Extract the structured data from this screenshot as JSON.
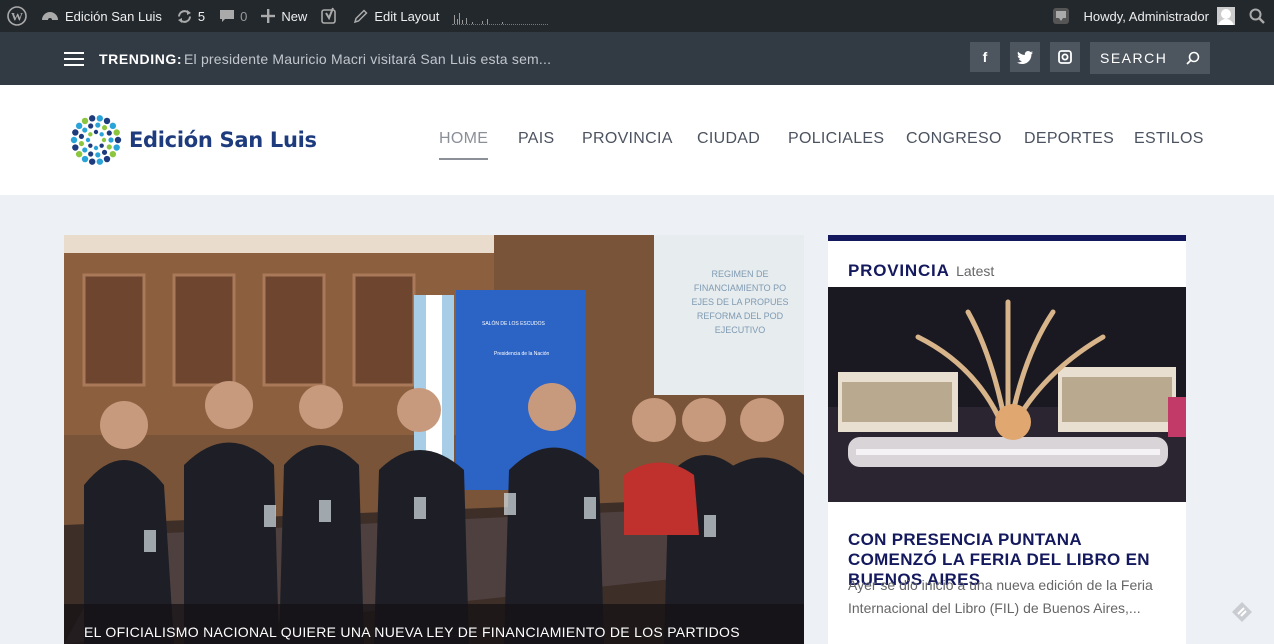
{
  "adminbar": {
    "site_name": "Edición San Luis",
    "updates_count": "5",
    "comments_count": "0",
    "new_label": "New",
    "edit_layout_label": "Edit Layout",
    "howdy_label": "Howdy, Administrador"
  },
  "trending": {
    "label": "TRENDING:",
    "headline": "El presidente Mauricio Macri visitará San Luis esta sem..."
  },
  "social": {
    "facebook_glyph": "f",
    "search_placeholder": "SEARCH"
  },
  "logo": {
    "text": "Edición San Luis"
  },
  "nav": {
    "items": [
      "HOME",
      "PAIS",
      "PROVINCIA",
      "CIUDAD",
      "POLICIALES",
      "CONGRESO",
      "DEPORTES",
      "ESTILOS"
    ],
    "active": "HOME"
  },
  "hero": {
    "title": "EL OFICIALISMO NACIONAL QUIERE UNA NUEVA LEY DE FINANCIAMIENTO DE LOS PARTIDOS"
  },
  "sidebar": {
    "category": "PROVINCIA",
    "latest": "Latest",
    "title": "CON PRESENCIA PUNTANA COMENZÓ LA FERIA DEL LIBRO EN BUENOS AIRES",
    "excerpt": "Ayer se dio inicio a una nueva edición de la Feria Internacional del Libro (FIL) de Buenos Aires,..."
  },
  "colors": {
    "adminbar": "#23282d",
    "trendbar": "#323a44",
    "accent_navy": "#14195e",
    "logo_blue": "#1e3b7e",
    "page_bg": "#edf0f4"
  }
}
